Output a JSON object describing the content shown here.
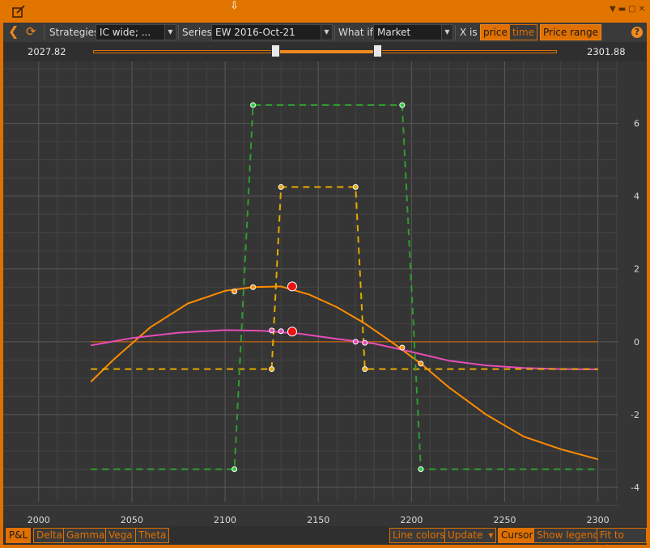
{
  "window": {
    "icon": "edit-window-icon"
  },
  "toolbar": {
    "strategies_label": "Strategies",
    "strategies_value": "IC wide; ...",
    "series_label": "Series",
    "series_value": "EW 2016-Oct-21",
    "whatif_label": "What if",
    "whatif_value": "Market",
    "xis_label": "X is",
    "price_btn": "price",
    "time_btn": "time",
    "price_range_btn": "Price range",
    "help": "?"
  },
  "range": {
    "min_label": "2027.82",
    "max_label": "2301.88",
    "low_fraction": 0.386,
    "high_fraction": 0.606
  },
  "chart_data": {
    "type": "line",
    "x_ticks": [
      "2000",
      "2050",
      "2100",
      "2150",
      "2200",
      "2250",
      "2300"
    ],
    "y_ticks": [
      "6",
      "4",
      "2",
      "0",
      "-2",
      "-4"
    ],
    "xlim": [
      1981,
      2311
    ],
    "ylim": [
      -4.4,
      7.7
    ],
    "series": [
      {
        "color": "#ff8c00",
        "style": "solid",
        "points": [
          [
            2028,
            -1.1
          ],
          [
            2040,
            -0.5
          ],
          [
            2060,
            0.4
          ],
          [
            2080,
            1.05
          ],
          [
            2100,
            1.4
          ],
          [
            2115,
            1.5
          ],
          [
            2130,
            1.52
          ],
          [
            2145,
            1.3
          ],
          [
            2160,
            0.95
          ],
          [
            2175,
            0.5
          ],
          [
            2190,
            -0.03
          ],
          [
            2205,
            -0.6
          ],
          [
            2220,
            -1.25
          ],
          [
            2240,
            -2.0
          ],
          [
            2260,
            -2.6
          ],
          [
            2280,
            -2.95
          ],
          [
            2300,
            -3.23
          ]
        ]
      },
      {
        "color": "#e74cb8",
        "style": "solid",
        "points": [
          [
            2028,
            -0.1
          ],
          [
            2050,
            0.1
          ],
          [
            2075,
            0.25
          ],
          [
            2100,
            0.32
          ],
          [
            2120,
            0.3
          ],
          [
            2140,
            0.22
          ],
          [
            2160,
            0.08
          ],
          [
            2180,
            -0.05
          ],
          [
            2200,
            -0.28
          ],
          [
            2220,
            -0.52
          ],
          [
            2240,
            -0.65
          ],
          [
            2260,
            -0.72
          ],
          [
            2280,
            -0.75
          ],
          [
            2300,
            -0.76
          ]
        ]
      },
      {
        "color": "#e6a800",
        "style": "dashed",
        "points": [
          [
            2028,
            -0.75
          ],
          [
            2125,
            -0.75
          ],
          [
            2130,
            4.25
          ],
          [
            2170,
            4.25
          ],
          [
            2175,
            -0.75
          ],
          [
            2300,
            -0.75
          ]
        ]
      },
      {
        "color": "#2e9e2e",
        "style": "dashed",
        "points": [
          [
            2028,
            -3.5
          ],
          [
            2105,
            -3.5
          ],
          [
            2115,
            6.5
          ],
          [
            2195,
            6.5
          ],
          [
            2205,
            -3.5
          ],
          [
            2300,
            -3.5
          ]
        ]
      }
    ],
    "zero_line": 0,
    "markers": [
      {
        "x": 2105,
        "y": -3.5,
        "kind": "green-point"
      },
      {
        "x": 2115,
        "y": 6.5,
        "kind": "green-point"
      },
      {
        "x": 2195,
        "y": 6.5,
        "kind": "green-point"
      },
      {
        "x": 2205,
        "y": -3.5,
        "kind": "green-point"
      },
      {
        "x": 2125,
        "y": -0.75,
        "kind": "yellow-point"
      },
      {
        "x": 2130,
        "y": 4.25,
        "kind": "yellow-point"
      },
      {
        "x": 2170,
        "y": 4.25,
        "kind": "yellow-point"
      },
      {
        "x": 2175,
        "y": -0.75,
        "kind": "yellow-point"
      },
      {
        "x": 2105,
        "y": 1.38,
        "kind": "orange-point"
      },
      {
        "x": 2115,
        "y": 1.5,
        "kind": "orange-point"
      },
      {
        "x": 2195,
        "y": -0.16,
        "kind": "orange-point"
      },
      {
        "x": 2205,
        "y": -0.6,
        "kind": "orange-point"
      },
      {
        "x": 2125,
        "y": 0.31,
        "kind": "pink-point"
      },
      {
        "x": 2130,
        "y": 0.29,
        "kind": "pink-point"
      },
      {
        "x": 2170,
        "y": 0.0,
        "kind": "pink-point"
      },
      {
        "x": 2175,
        "y": -0.03,
        "kind": "pink-point"
      },
      {
        "x": 2136,
        "y": 1.52,
        "kind": "cursor-red"
      },
      {
        "x": 2136,
        "y": 0.28,
        "kind": "cursor-red"
      }
    ]
  },
  "bottom": {
    "tabs": [
      "P&L",
      "Delta",
      "Gamma",
      "Vega",
      "Theta"
    ],
    "line_colors": "Line colors",
    "update": "Update",
    "cursor": "Cursor",
    "show_legend": "Show legend",
    "fit_to_view": "Fit to view"
  }
}
